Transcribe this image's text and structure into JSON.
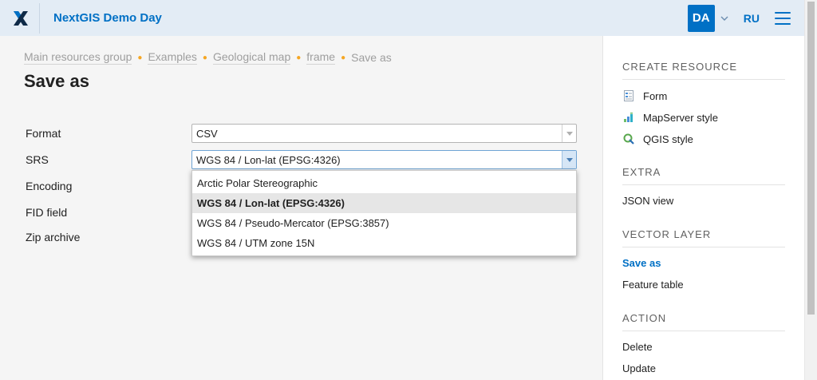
{
  "header": {
    "app_title": "NextGIS Demo Day",
    "avatar": "DA",
    "lang": "RU",
    "accent": "#0070c5"
  },
  "breadcrumb": {
    "items": [
      "Main resources group",
      "Examples",
      "Geological map",
      "frame"
    ],
    "current": "Save as"
  },
  "page": {
    "title": "Save as"
  },
  "form": {
    "format_label": "Format",
    "format_value": "CSV",
    "srs_label": "SRS",
    "srs_value": "WGS 84 / Lon-lat (EPSG:4326)",
    "encoding_label": "Encoding",
    "fid_label": "FID field",
    "zip_label": "Zip archive"
  },
  "srs_dropdown": {
    "options": [
      "Arctic Polar Stereographic",
      "WGS 84 / Lon-lat (EPSG:4326)",
      "WGS 84 / Pseudo-Mercator (EPSG:3857)",
      "WGS 84 / UTM zone 15N"
    ],
    "selected_index": 1
  },
  "sidebar": {
    "create_title": "CREATE RESOURCE",
    "create_items": [
      {
        "label": "Form",
        "icon": "form-icon"
      },
      {
        "label": "MapServer style",
        "icon": "mapserver-style-icon"
      },
      {
        "label": "QGIS style",
        "icon": "qgis-style-icon"
      }
    ],
    "extra_title": "EXTRA",
    "extra_items": [
      "JSON view"
    ],
    "vector_title": "VECTOR LAYER",
    "vector_items": [
      "Save as",
      "Feature table"
    ],
    "action_title": "ACTION",
    "action_items": [
      "Delete",
      "Update"
    ]
  }
}
